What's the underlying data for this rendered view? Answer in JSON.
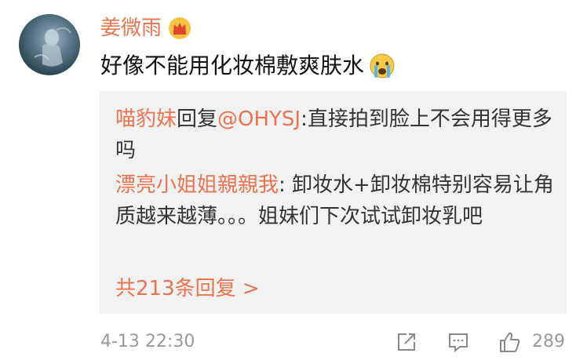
{
  "comment": {
    "username": "姜微雨",
    "text": "好像不能用化妆棉敷爽肤水",
    "badge_icon": "crown-icon",
    "emoji_icon": "crying-face-icon"
  },
  "replies": [
    {
      "user": "喵豹妹",
      "reply_word": "回复",
      "mention": "@OHYSJ",
      "text": ":直接拍到脸上不会用得更多吗"
    },
    {
      "user": "漂亮小姐姐親親我",
      "text": ": 卸妆水+卸妆棉特别容易让角质越来越薄。。。姐妹们下次试试卸妆乳吧"
    }
  ],
  "more_replies_label": "共213条回复 >",
  "footer": {
    "timestamp": "4-13 22:30",
    "like_count": "289"
  },
  "colors": {
    "accent": "#eb7350",
    "text": "#111111",
    "secondary_text": "#999999",
    "reply_background": "#f2f2f2"
  }
}
